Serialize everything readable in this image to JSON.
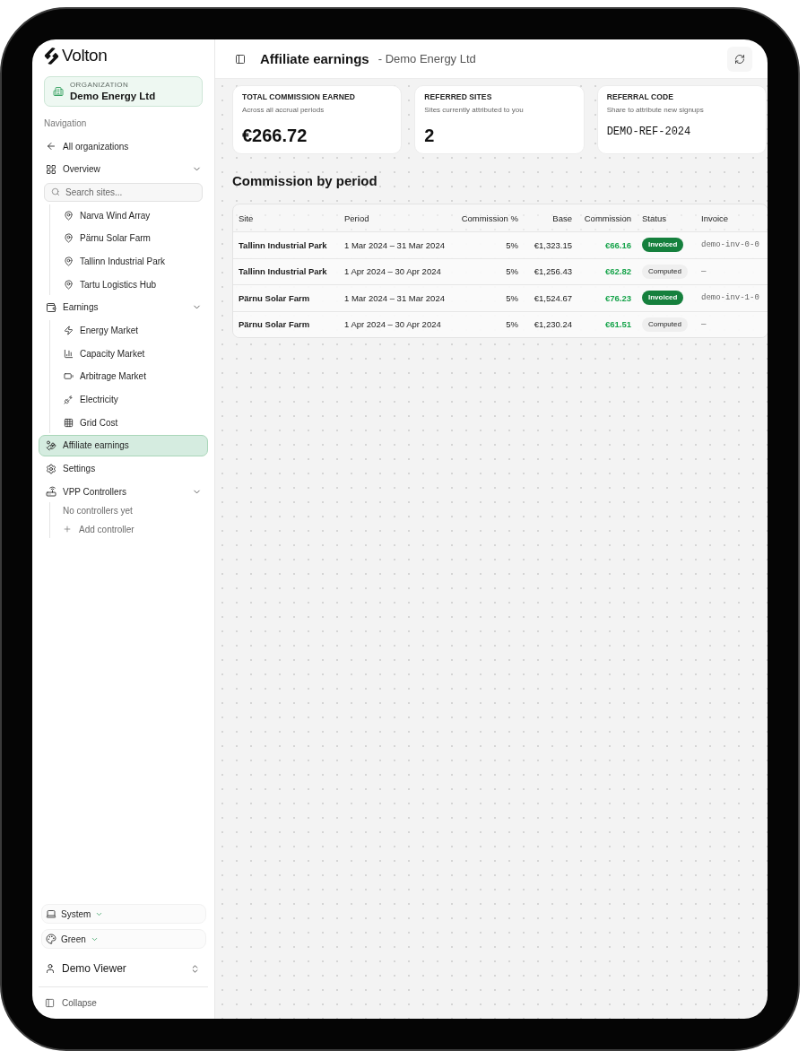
{
  "sidebar": {
    "brand": "Volton",
    "organization": {
      "label": "ORGANIZATION",
      "name": "Demo Energy Ltd"
    },
    "section_label": "Navigation",
    "items": [
      {
        "kind": "link",
        "label": "All organizations",
        "selected": false
      },
      {
        "kind": "group",
        "label": "Overview",
        "expanded": true,
        "selected": false,
        "search": {
          "placeholder": "Search sites..."
        },
        "children": [
          {
            "label": "Narva Wind Array",
            "selected": false
          },
          {
            "label": "Pärnu Solar Farm",
            "selected": false
          },
          {
            "label": "Tallinn Industrial Park",
            "selected": false
          },
          {
            "label": "Tartu Logistics Hub",
            "selected": false
          }
        ]
      },
      {
        "kind": "group",
        "label": "Earnings",
        "expanded": true,
        "selected": false,
        "children": [
          {
            "label": "Energy Market",
            "selected": false
          },
          {
            "label": "Capacity Market",
            "selected": false
          },
          {
            "label": "Arbitrage Market",
            "selected": false
          },
          {
            "label": "Electricity",
            "selected": false
          },
          {
            "label": "Grid Cost",
            "selected": false
          }
        ]
      },
      {
        "kind": "link",
        "label": "Affiliate earnings",
        "selected": true
      },
      {
        "kind": "link",
        "label": "Settings",
        "selected": false
      },
      {
        "kind": "group",
        "label": "VPP Controllers",
        "expanded": true,
        "selected": false,
        "empty_text": "No controllers yet",
        "add_label": "Add controller"
      }
    ],
    "footer": {
      "theme_mode": "System",
      "color_theme": "Green",
      "user": "Demo Viewer",
      "collapse": "Collapse"
    }
  },
  "header": {
    "title": "Affiliate earnings",
    "subtitle": "- Demo Energy Ltd"
  },
  "stats": [
    {
      "kind": "amount",
      "label": "TOTAL COMMISSION EARNED",
      "caption": "Across all accrual periods",
      "value": "€266.72"
    },
    {
      "kind": "count",
      "label": "REFERRED SITES",
      "caption": "Sites currently attributed to you",
      "value": "2"
    },
    {
      "kind": "code",
      "label": "REFERRAL CODE",
      "caption": "Share to attribute new signups",
      "value": "DEMO-REF-2024"
    }
  ],
  "table": {
    "title": "Commission by period",
    "columns": [
      "Site",
      "Period",
      "Commission %",
      "Base",
      "Commission",
      "Status",
      "Invoice"
    ],
    "rows": [
      {
        "site": "Tallinn Industrial Park",
        "period": "1 Mar 2024 – 31 Mar 2024",
        "rate": "5%",
        "base": "€1,323.15",
        "commission": "€66.16",
        "status": {
          "kind": "invoiced",
          "label": "Invoiced"
        },
        "invoice": "demo-inv-0-0"
      },
      {
        "site": "Tallinn Industrial Park",
        "period": "1 Apr 2024 – 30 Apr 2024",
        "rate": "5%",
        "base": "€1,256.43",
        "commission": "€62.82",
        "status": {
          "kind": "computed",
          "label": "Computed"
        },
        "invoice": "—"
      },
      {
        "site": "Pärnu Solar Farm",
        "period": "1 Mar 2024 – 31 Mar 2024",
        "rate": "5%",
        "base": "€1,524.67",
        "commission": "€76.23",
        "status": {
          "kind": "invoiced",
          "label": "Invoiced"
        },
        "invoice": "demo-inv-1-0"
      },
      {
        "site": "Pärnu Solar Farm",
        "period": "1 Apr 2024 – 30 Apr 2024",
        "rate": "5%",
        "base": "€1,230.24",
        "commission": "€61.51",
        "status": {
          "kind": "computed",
          "label": "Computed"
        },
        "invoice": "—"
      }
    ]
  }
}
